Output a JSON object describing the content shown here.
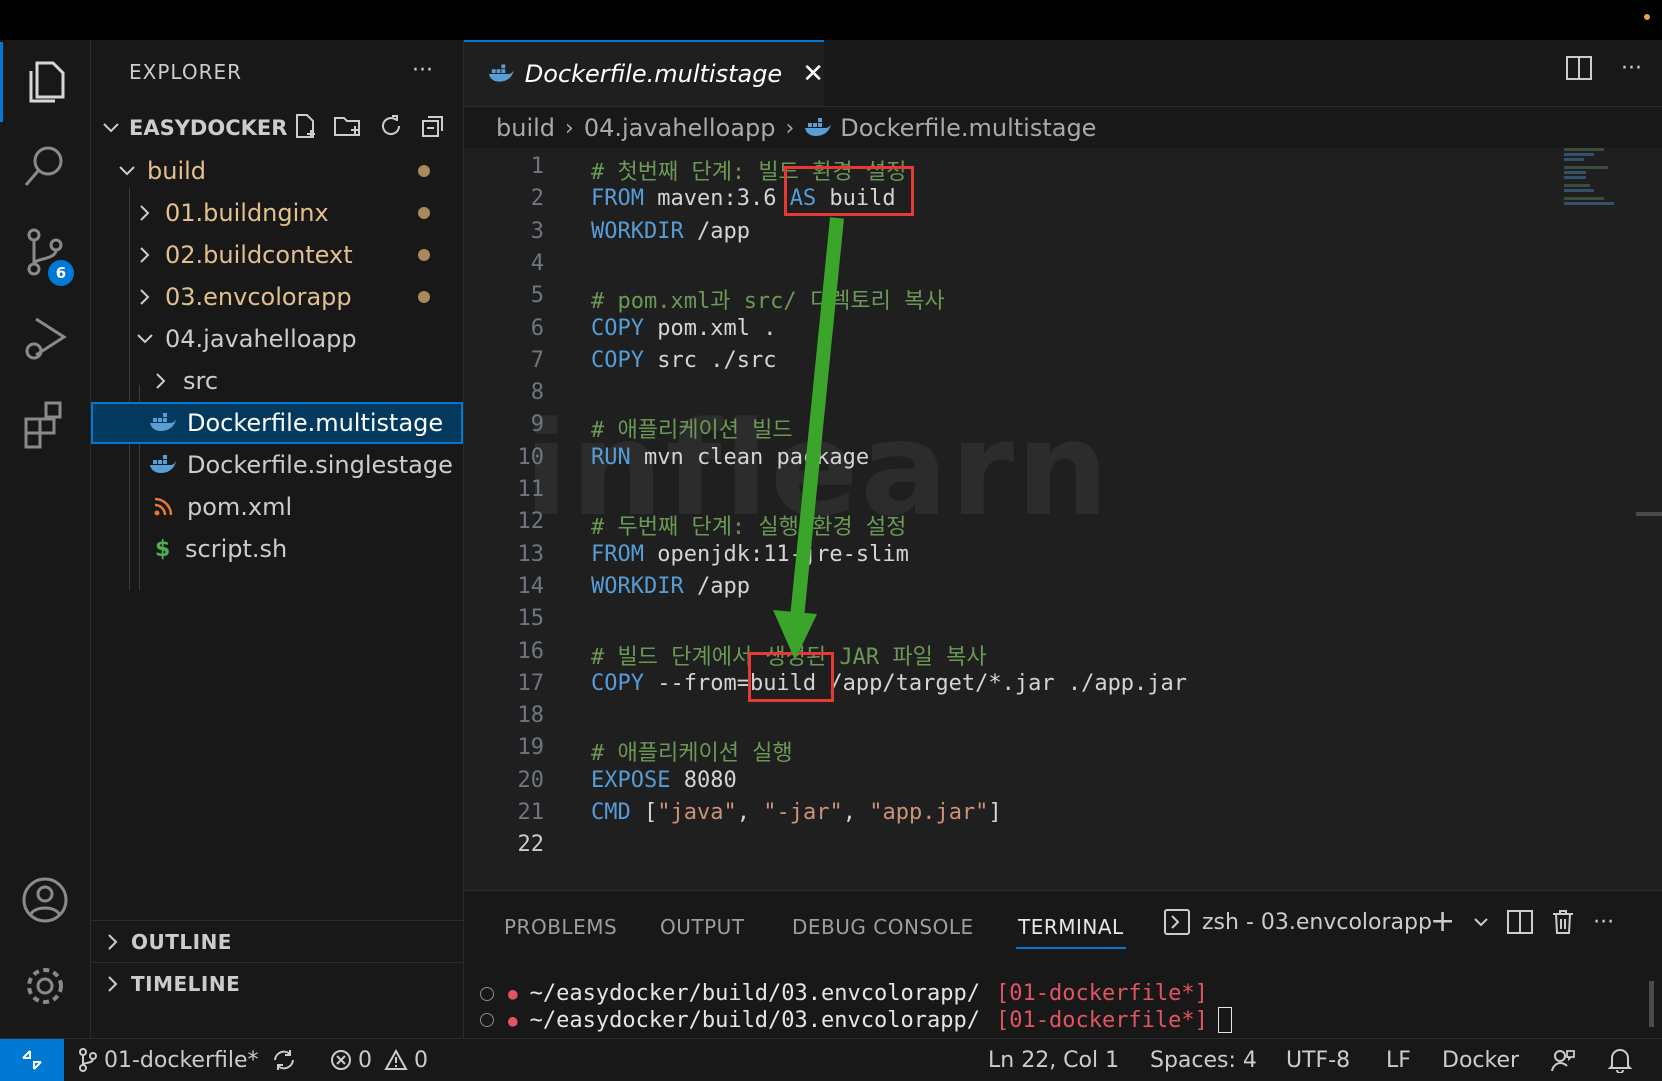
{
  "explorer": {
    "title": "EXPLORER",
    "root": "EASYDOCKER",
    "tree": [
      {
        "label": "build",
        "modified": true
      },
      {
        "label": "01.buildnginx",
        "modified": true
      },
      {
        "label": "02.buildcontext",
        "modified": true
      },
      {
        "label": "03.envcolorapp",
        "modified": true
      },
      {
        "label": "04.javahelloapp"
      },
      {
        "label": "src"
      },
      {
        "label": "Dockerfile.multistage"
      },
      {
        "label": "Dockerfile.singlestage"
      },
      {
        "label": "pom.xml"
      },
      {
        "label": "script.sh"
      }
    ],
    "outline": "OUTLINE",
    "timeline": "TIMELINE"
  },
  "activity": {
    "scm_badge": "6"
  },
  "tab": {
    "name": "Dockerfile.multistage"
  },
  "breadcrumb": [
    "build",
    "04.javahelloapp",
    "Dockerfile.multistage"
  ],
  "code": {
    "line_numbers": [
      "1",
      "2",
      "3",
      "4",
      "5",
      "6",
      "7",
      "8",
      "9",
      "10",
      "11",
      "12",
      "13",
      "14",
      "15",
      "16",
      "17",
      "18",
      "19",
      "20",
      "21",
      "22"
    ],
    "lines": [
      [
        {
          "t": "# 첫번째 단계: 빌드 환경 설정",
          "c": "cm"
        }
      ],
      [
        {
          "t": "FROM",
          "c": "kw"
        },
        {
          "t": " maven:3.6 ",
          "c": "pl"
        },
        {
          "t": "AS",
          "c": "kw"
        },
        {
          "t": " build",
          "c": "pl"
        }
      ],
      [
        {
          "t": "WORKDIR",
          "c": "kw"
        },
        {
          "t": " /app",
          "c": "pl"
        }
      ],
      [],
      [
        {
          "t": "# pom.xml과 src/ 디렉토리 복사",
          "c": "cm"
        }
      ],
      [
        {
          "t": "COPY",
          "c": "kw"
        },
        {
          "t": " pom.xml .",
          "c": "pl"
        }
      ],
      [
        {
          "t": "COPY",
          "c": "kw"
        },
        {
          "t": " src ./src",
          "c": "pl"
        }
      ],
      [],
      [
        {
          "t": "# 애플리케이션 빌드",
          "c": "cm"
        }
      ],
      [
        {
          "t": "RUN",
          "c": "kw"
        },
        {
          "t": " mvn clean package",
          "c": "pl"
        }
      ],
      [],
      [
        {
          "t": "# 두번째 단계: 실행 환경 설정",
          "c": "cm"
        }
      ],
      [
        {
          "t": "FROM",
          "c": "kw"
        },
        {
          "t": " openjdk:11-jre-slim",
          "c": "pl"
        }
      ],
      [
        {
          "t": "WORKDIR",
          "c": "kw"
        },
        {
          "t": " /app",
          "c": "pl"
        }
      ],
      [],
      [
        {
          "t": "# 빌드 단계에서 생성된 JAR 파일 복사",
          "c": "cm"
        }
      ],
      [
        {
          "t": "COPY",
          "c": "kw"
        },
        {
          "t": " --from=build /app/target/*.jar ./app.jar",
          "c": "pl"
        }
      ],
      [],
      [
        {
          "t": "# 애플리케이션 실행",
          "c": "cm"
        }
      ],
      [
        {
          "t": "EXPOSE",
          "c": "kw"
        },
        {
          "t": " 8080",
          "c": "pl"
        }
      ],
      [
        {
          "t": "CMD",
          "c": "kw"
        },
        {
          "t": " [",
          "c": "pl"
        },
        {
          "t": "\"java\"",
          "c": "str"
        },
        {
          "t": ", ",
          "c": "pl"
        },
        {
          "t": "\"-jar\"",
          "c": "str"
        },
        {
          "t": ", ",
          "c": "pl"
        },
        {
          "t": "\"app.jar\"",
          "c": "str"
        },
        {
          "t": "]",
          "c": "pl"
        }
      ],
      []
    ],
    "current_line": "22"
  },
  "watermark": "inflearn",
  "panel": {
    "tabs": [
      "PROBLEMS",
      "OUTPUT",
      "DEBUG CONSOLE",
      "TERMINAL"
    ],
    "active_tab": "TERMINAL",
    "terminal_name": "zsh - 03.envcolorapp",
    "terminal_lines": [
      {
        "path": "~/easydocker/build/03.envcolorapp/",
        "branch": "[01-dockerfile*]"
      },
      {
        "path": "~/easydocker/build/03.envcolorapp/",
        "branch": "[01-dockerfile*]"
      }
    ]
  },
  "status": {
    "branch": "01-dockerfile*",
    "errors": "0",
    "warnings": "0",
    "position": "Ln 22, Col 1",
    "spaces": "Spaces: 4",
    "encoding": "UTF-8",
    "eol": "LF",
    "language": "Docker"
  },
  "colors": {
    "accent": "#0078d4",
    "annotation_red": "#e53935",
    "annotation_arrow": "#3aa52a"
  }
}
